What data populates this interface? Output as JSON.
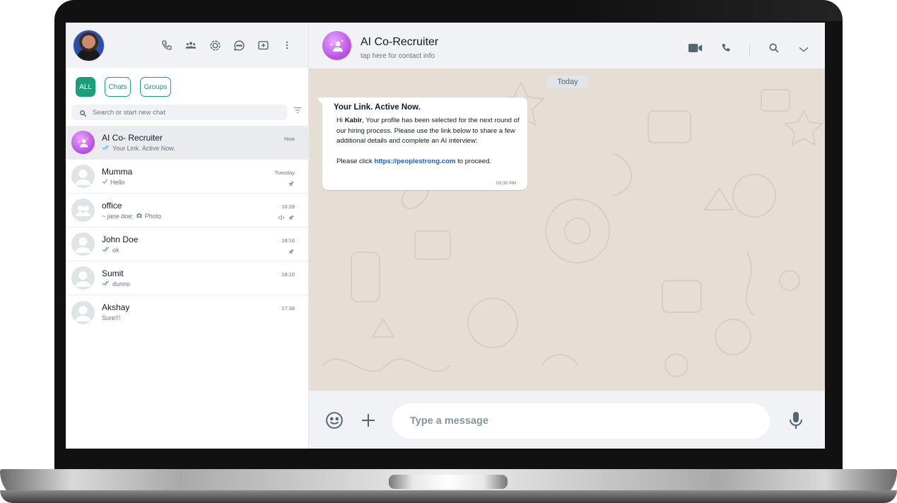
{
  "sidebar": {
    "filters": [
      "ALL",
      "Chats",
      "Groups"
    ],
    "search_placeholder": "Search or start new chat",
    "chats": [
      {
        "name": "AI Co- Recruiter",
        "preview": "Your Link. Active Now.",
        "time": "Now",
        "pinned": false,
        "muted": false,
        "ticks": "double-blue"
      },
      {
        "name": "Mumma",
        "preview": "Hello",
        "time": "Tuesday",
        "pinned": true,
        "muted": false,
        "ticks": "single"
      },
      {
        "name": "office",
        "preview_sender": "~ jane doe:",
        "preview": "Photo",
        "time": "16:28",
        "pinned": true,
        "muted": true
      },
      {
        "name": "John Doe",
        "preview": "ok",
        "time": "18:16",
        "pinned": true,
        "muted": false,
        "ticks": "double"
      },
      {
        "name": "Sumit",
        "preview": "dunno",
        "time": "18:10",
        "pinned": false,
        "muted": false,
        "ticks": "double"
      },
      {
        "name": "Akshay",
        "preview": "Sure!!!",
        "time": "17:38",
        "pinned": false,
        "muted": false
      }
    ]
  },
  "conversation": {
    "title": "AI Co-Recruiter",
    "subtitle": "tap here for contact info",
    "date_divider": "Today",
    "message": {
      "title": "Your Link. Active Now.",
      "greeting_prefix": "Hi ",
      "name": "Kabir",
      "body_1": ", Your profile has been selected for the next round of our hiring process. Please use the link below to share a few additional details and complete an AI interview:",
      "body_2_prefix": "Please click ",
      "link": "https://peoplestrong.com",
      "body_2_suffix": " to proceed.",
      "time": "03:30 PM"
    },
    "composer_placeholder": "Type a message"
  },
  "colors": {
    "accent": "#1b9e7a",
    "link": "#1f5ec9",
    "ai_avatar": "#b64ce0"
  }
}
